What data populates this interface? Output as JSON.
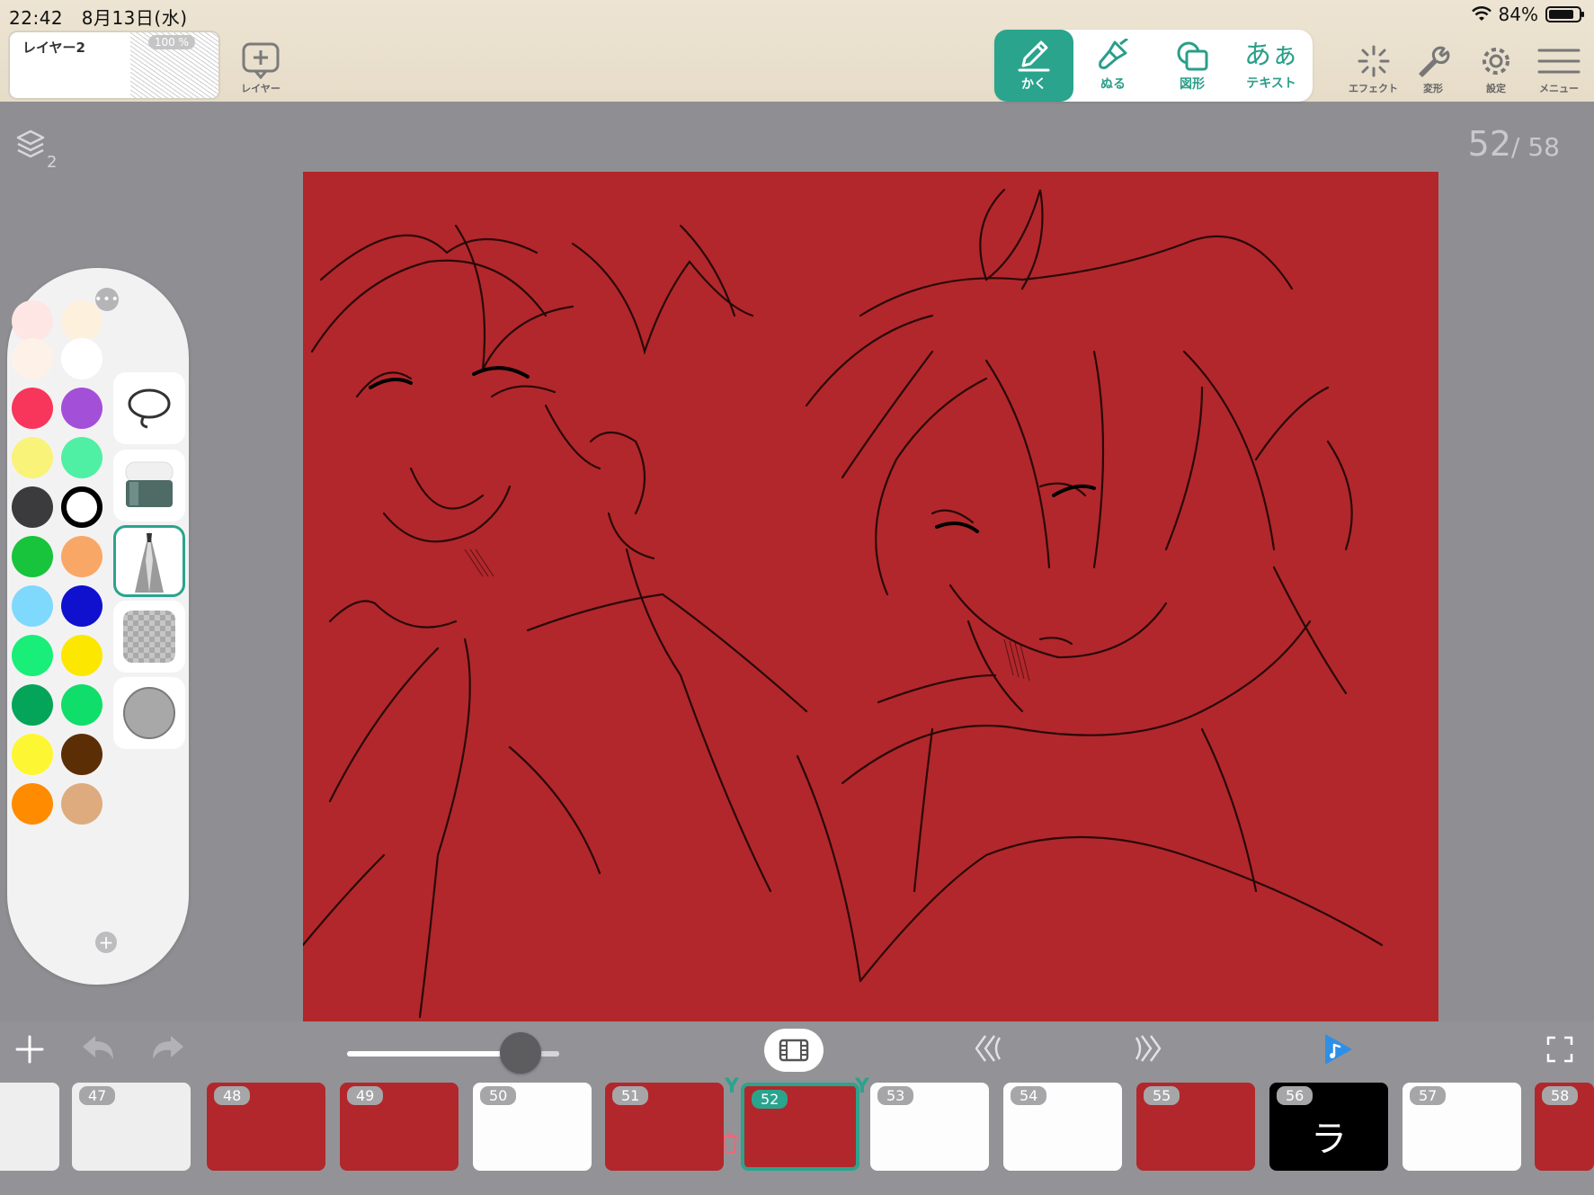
{
  "status_bar": {
    "time": "22:42",
    "date": "8月13日(水)",
    "battery": "84%",
    "battery_level": 0.84
  },
  "layer_panel": {
    "layer_name": "レイヤー2",
    "opacity": "100 %",
    "add_layer_label": "レイヤー"
  },
  "tools": [
    {
      "id": "draw",
      "label": "かく",
      "active": true
    },
    {
      "id": "fill",
      "label": "ぬる",
      "active": false
    },
    {
      "id": "shape",
      "label": "図形",
      "active": false
    },
    {
      "id": "text",
      "label": "テキスト",
      "glyph": "あぁ",
      "active": false
    }
  ],
  "right_menu": {
    "effect": "エフェクト",
    "transform": "変形",
    "settings": "設定",
    "menu": "メニュー"
  },
  "canvas_info": {
    "layer_count": "2",
    "current_page": "52",
    "total_pages": "/ 58"
  },
  "palette": {
    "colors": [
      "#fde6e3",
      "#fdf1dd",
      "#fdf1e8",
      "#ffffff",
      "#f8355a",
      "#a44fd8",
      "#f9f37a",
      "#4ff0a3",
      "#3b3b3d",
      "#ffffff",
      "#17c43b",
      "#f9a767",
      "#7fd9fd",
      "#0f11cf",
      "#18ee78",
      "#fbe700",
      "#04a559",
      "#0fde6a",
      "#fdf733",
      "#5b2e06",
      "#ff8b00",
      "#ddab7d"
    ],
    "tools": [
      "lasso",
      "eraser",
      "pen",
      "transparent",
      "gray-brush"
    ]
  },
  "frames": [
    {
      "num": "",
      "kind": "sketchy"
    },
    {
      "num": "47",
      "kind": "sketchy"
    },
    {
      "num": "48",
      "kind": "red"
    },
    {
      "num": "49",
      "kind": "red"
    },
    {
      "num": "50",
      "kind": "white"
    },
    {
      "num": "51",
      "kind": "red"
    },
    {
      "num": "52",
      "kind": "red",
      "active": true
    },
    {
      "num": "53",
      "kind": "white"
    },
    {
      "num": "54",
      "kind": "white"
    },
    {
      "num": "55",
      "kind": "red"
    },
    {
      "num": "56",
      "kind": "black",
      "glyph": "ラ"
    },
    {
      "num": "57",
      "kind": "white"
    },
    {
      "num": "58",
      "kind": "red"
    }
  ],
  "colors": {
    "accent": "#2aa48d",
    "canvas": "#b2272b",
    "topbar": "#ede4d3",
    "workspace": "#8f8f93"
  }
}
